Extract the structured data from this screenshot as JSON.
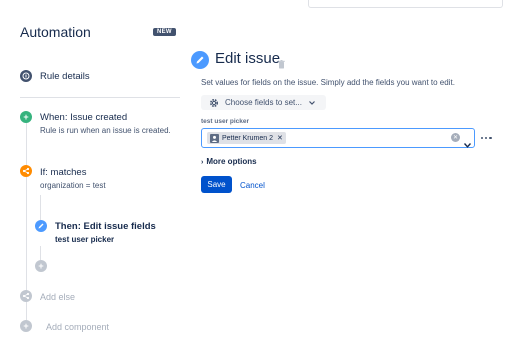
{
  "sidebar": {
    "title": "Automation",
    "badge": "NEW",
    "rule_details": "Rule details",
    "trigger": {
      "title": "When: Issue created",
      "subtitle": "Rule is run when an issue is created."
    },
    "condition": {
      "title": "If: matches",
      "subtitle": "organization = test"
    },
    "action": {
      "title": "Then: Edit issue fields",
      "subtitle": "test user picker"
    },
    "add_else": "Add else",
    "add_component": "Add component"
  },
  "editor": {
    "title": "Edit issue",
    "description": "Set values for fields on the issue. Simply add the fields you want to edit.",
    "choose_fields": "Choose fields to set...",
    "field_label": "test user picker",
    "chip_label": "Petter Krumen 2",
    "more_options": "More options",
    "save": "Save",
    "cancel": "Cancel"
  },
  "colors": {
    "accent": "#0052cc",
    "trigger_green": "#36b37e",
    "condition_orange": "#ff8b00",
    "action_blue": "#4c9aff",
    "info_navy": "#42526e",
    "disabled_gray": "#c1c7d0"
  }
}
